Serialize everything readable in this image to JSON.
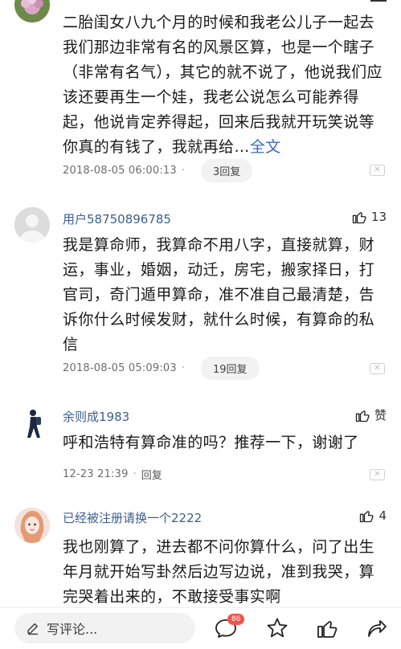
{
  "comments": [
    {
      "username": "",
      "likes": "",
      "text": "二胎闺女八九个月的时候和我老公儿子一起去我们那边非常有名的风景区算，也是一个瞎子（非常有名气），其它的就不说了，他说我们应该还要再生一个娃，我老公说怎么可能养得起，他说肯定养得起，回来后我就开玩笑说等你真的有钱了，我就再给…",
      "fulltext_label": "全文",
      "time": "2018-08-05 06:00:13",
      "replies": "3回复"
    },
    {
      "username": "用户58750896785",
      "likes": "13",
      "text": "我是算命师，我算命不用八字，直接就算，财运，事业，婚姻，动迁，房宅，搬家择日，打官司，奇门遁甲算命，准不准自己最清楚，告诉你什么时候发财，就什么时候，有算命的私信",
      "time": "2018-08-05 05:09:03",
      "replies": "19回复"
    },
    {
      "username": "余则成1983",
      "likes": "赞",
      "text": "呼和浩特有算命准的吗？推荐一下，谢谢了",
      "time": "12-23 21:39",
      "replies": "回复"
    },
    {
      "username": "已经被注册请换一个2222",
      "likes": "4",
      "text": "我也刚算了，进去都不问你算什么，问了出生年月就开始写卦然后边写边说，准到我哭，算完哭着出来的，不敢接受事实啊"
    }
  ],
  "bottom_bar": {
    "write_placeholder": "写评论...",
    "comment_count": "86",
    "icons": [
      "edit-icon",
      "comment-icon",
      "star-icon",
      "thumbs-up-icon",
      "share-icon"
    ]
  },
  "colors": {
    "username": "#3c5e8f",
    "fulltext": "#3d6ab8",
    "badge": "#f0554b"
  }
}
